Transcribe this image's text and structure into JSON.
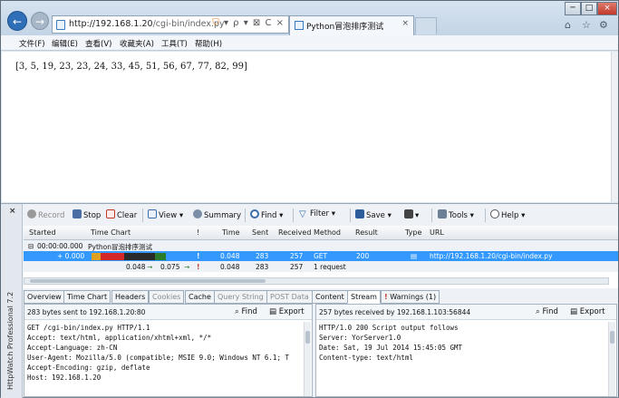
{
  "browser": {
    "url_host": "http://192.168.1.20",
    "url_path": "/cgi-bin/index.py",
    "tab_title": "Python冒泡排序测试",
    "tab_close": "×",
    "nav_back": "←",
    "nav_forward": "→",
    "address_tools": "▾ ρ ▾ ⊠ C ×",
    "window_min": "─",
    "window_max": "□",
    "window_close": "×",
    "home": "⌂",
    "favorites": "☆",
    "settings": "⚙"
  },
  "menu": [
    "文件(F)",
    "编辑(E)",
    "查看(V)",
    "收藏夹(A)",
    "工具(T)",
    "帮助(H)"
  ],
  "page": {
    "result": "[3, 5, 19, 23, 23, 24, 33, 45, 51, 56, 67, 77, 82, 99]"
  },
  "httpwatch": {
    "close": "×",
    "product": "HttpWatch Professional 7.2",
    "toolbar": {
      "record": "Record",
      "stop": "Stop",
      "clear": "Clear",
      "view": "View ▾",
      "summary": "Summary",
      "find": "Find ▾",
      "filter": "Filter ▾",
      "save": "Save ▾",
      "print": "▾",
      "tools": "Tools ▾",
      "help": "Help ▾"
    },
    "columns": [
      "Started",
      "Time Chart",
      "!",
      "Time",
      "Sent",
      "Received",
      "Method",
      "Result",
      "Type",
      "URL"
    ],
    "page_row": {
      "started": "00:00:00.000",
      "title": "Python冒泡排序测试",
      "expander": "⊟"
    },
    "entry": {
      "started": "+ 0.000",
      "warn": "!",
      "time": "0.048",
      "sent": "283",
      "received": "257",
      "method": "GET",
      "result": "200",
      "url": "http://192.168.1.20/cgi-bin/index.py"
    },
    "summary": {
      "t1": "0.048",
      "arrow1": "→",
      "t2": "0.075",
      "arrow2": "→",
      "warn": "!",
      "time": "0.048",
      "sent": "283",
      "received": "257",
      "requests": "1 request"
    },
    "detail_tabs": [
      {
        "label": "Overview",
        "state": "normal"
      },
      {
        "label": "Time Chart",
        "state": "normal"
      },
      {
        "label": "Headers",
        "state": "normal"
      },
      {
        "label": "Cookies",
        "state": "dim"
      },
      {
        "label": "Cache",
        "state": "normal"
      },
      {
        "label": "Query String",
        "state": "dim"
      },
      {
        "label": "POST Data",
        "state": "dim"
      },
      {
        "label": "Content",
        "state": "normal"
      },
      {
        "label": "Stream",
        "state": "active"
      },
      {
        "label": "Warnings (1)",
        "state": "normal"
      }
    ],
    "warn_mark": "!",
    "left_pane": {
      "info": "283 bytes sent to 192.168.1.20:80",
      "find": "Find",
      "export": "Export",
      "lines": [
        "GET /cgi-bin/index.py HTTP/1.1",
        "Accept: text/html, application/xhtml+xml, */*",
        "Accept-Language: zh-CN",
        "User-Agent: Mozilla/5.0 (compatible; MSIE 9.0; Windows NT 6.1; T",
        "Accept-Encoding: gzip, deflate",
        "Host: 192.168.1.20"
      ]
    },
    "right_pane": {
      "info": "257 bytes received by 192.168.1.103:56844",
      "find": "Find",
      "export": "Export",
      "lines": [
        "HTTP/1.0 200 Script output follows",
        "Server: YorServer1.0",
        "Date: Sat, 19 Jul 2014 15:45:05 GMT",
        "Content-type: text/html"
      ]
    },
    "colors": {
      "selected_row": "#3399ff",
      "bar_wait": "#e0a020",
      "bar_receive": "#d42828",
      "bar_blocked": "#2a2a2a",
      "bar_load": "#2c7a2c"
    }
  }
}
